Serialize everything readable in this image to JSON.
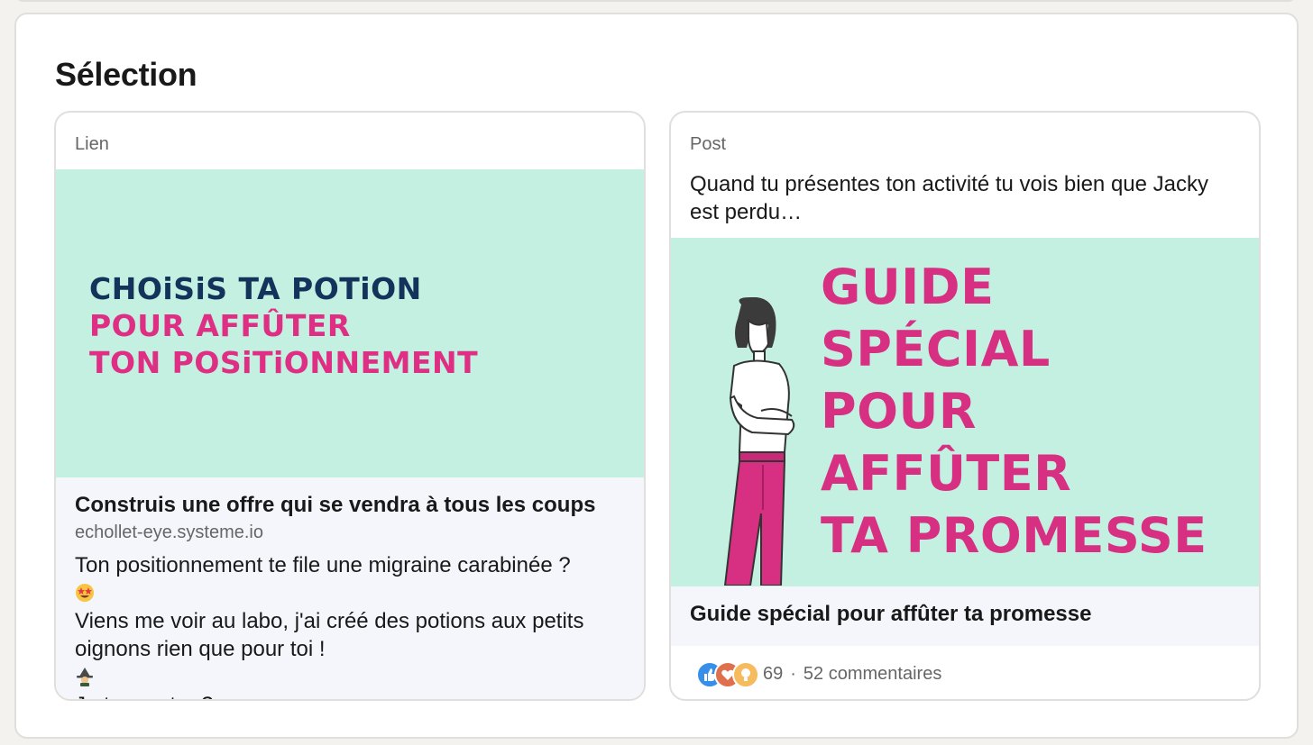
{
  "section": {
    "title": "Sélection"
  },
  "cards": [
    {
      "type_label": "Lien",
      "image_text": {
        "line1": "CHOiSiS TA POTiON",
        "line2": "POUR AFFÛTER",
        "line3": "TON POSiTiONNEMENT"
      },
      "title": "Construis une offre qui se vendra à tous les coups",
      "domain": "echollet-eye.systeme.io",
      "description": {
        "line1": "Ton positionnement te file une migraine carabinée ?",
        "line2_emoji": "star-struck-emoji",
        "line3": "Viens me voir au labo, j'ai créé des potions aux petits oignons rien que pour toi !",
        "line4_emoji": "witch-emoji",
        "line4": "Je te montre ?"
      }
    },
    {
      "type_label": "Post",
      "text": "Quand tu présentes ton activité tu vois bien que Jacky est perdu…",
      "image_text": {
        "line1": "GUIDE",
        "line2": "SPÉCIAL",
        "line3": "POUR",
        "line4": "AFFÛTER",
        "line5": "TA PROMESSE"
      },
      "title": "Guide spécial pour affûter ta promesse",
      "reactions": {
        "icons": [
          "like-icon",
          "love-icon",
          "insightful-icon"
        ],
        "count": "69",
        "separator": "·",
        "comments": "52 commentaires"
      }
    }
  ],
  "colors": {
    "image_bg": "#c3f0e1",
    "navy": "#14335a",
    "pink": "#de2f84",
    "card_footer_bg": "#f4f6fb"
  }
}
